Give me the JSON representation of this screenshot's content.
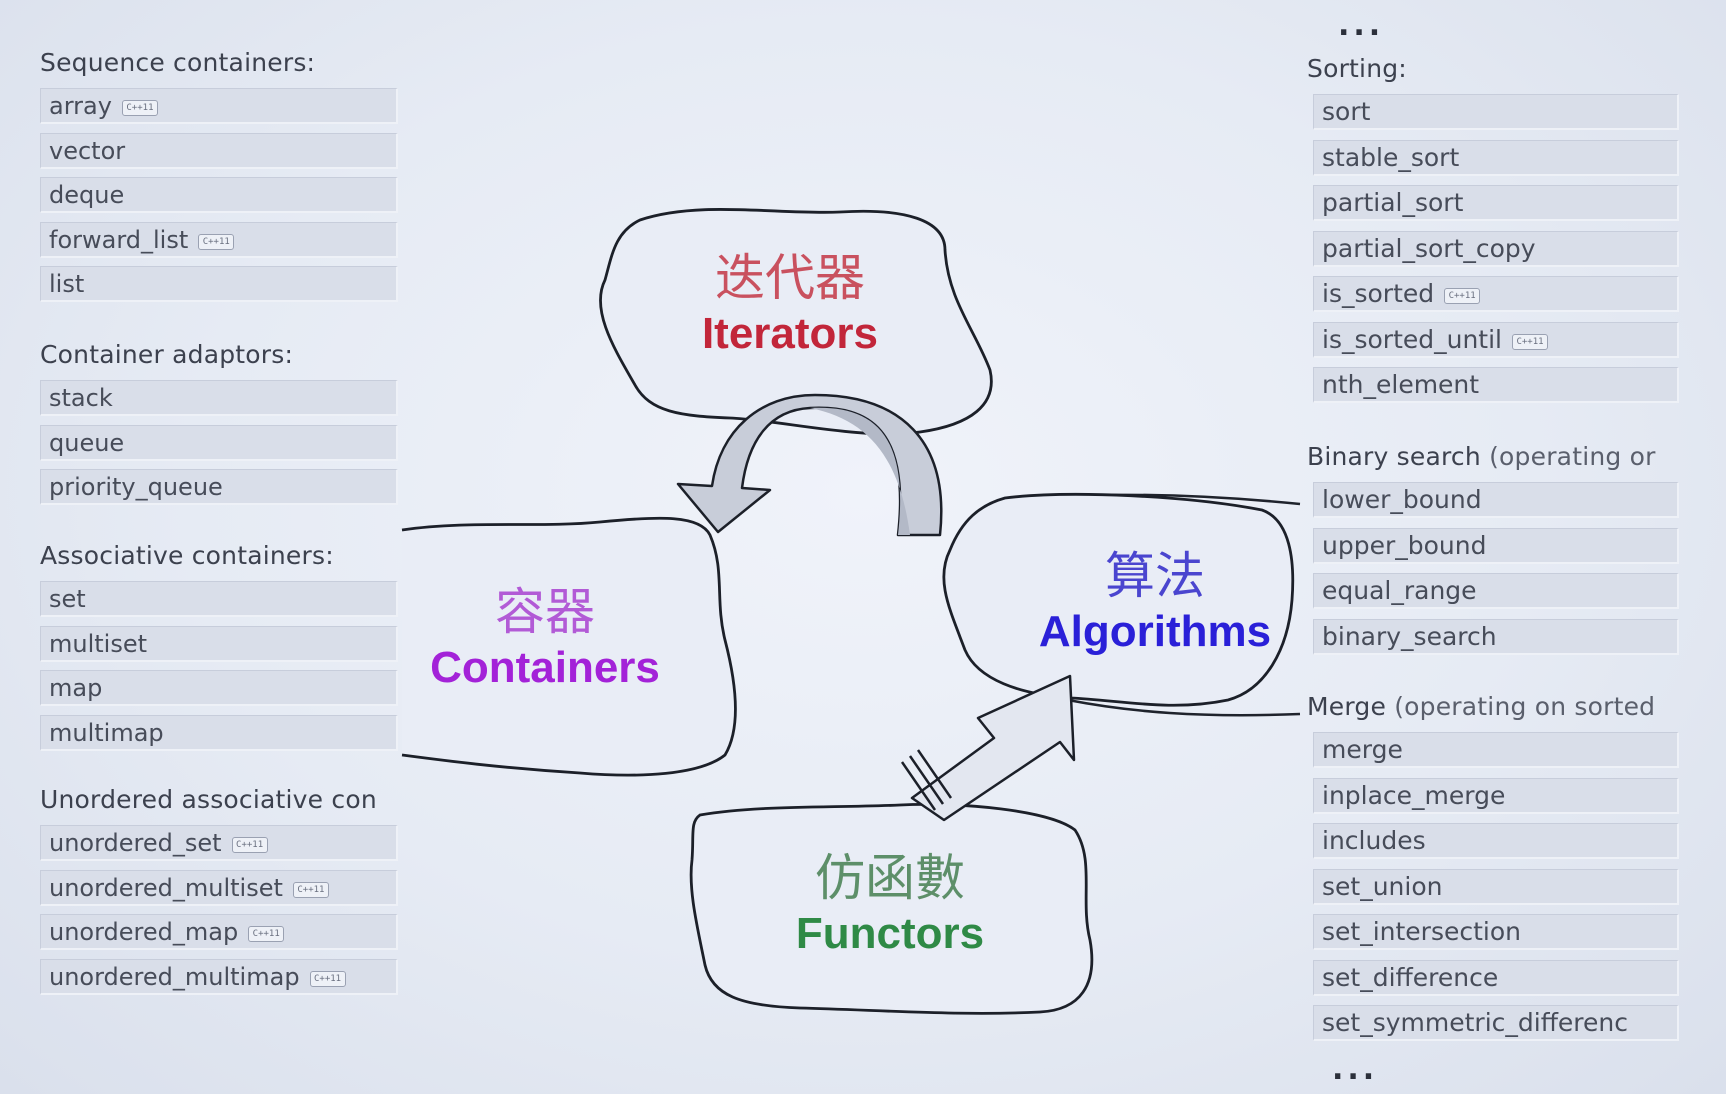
{
  "colors": {
    "iterators": "#c2263a",
    "iterators_cn": "#c9515f",
    "containers": "#a322d8",
    "containers_cn": "#b25ad6",
    "algorithms": "#2a20d8",
    "algorithms_cn": "#4a45cf",
    "functors": "#2f8a46",
    "functors_cn": "#5d8f69"
  },
  "left_groups": [
    {
      "heading": "Sequence containers:",
      "items": [
        {
          "label": "array",
          "cxx11": true
        },
        {
          "label": "vector",
          "cxx11": false
        },
        {
          "label": "deque",
          "cxx11": false
        },
        {
          "label": "forward_list",
          "cxx11": true
        },
        {
          "label": "list",
          "cxx11": false
        }
      ]
    },
    {
      "heading": "Container adaptors:",
      "items": [
        {
          "label": "stack",
          "cxx11": false
        },
        {
          "label": "queue",
          "cxx11": false
        },
        {
          "label": "priority_queue",
          "cxx11": false
        }
      ]
    },
    {
      "heading": "Associative containers:",
      "items": [
        {
          "label": "set",
          "cxx11": false
        },
        {
          "label": "multiset",
          "cxx11": false
        },
        {
          "label": "map",
          "cxx11": false
        },
        {
          "label": "multimap",
          "cxx11": false
        }
      ]
    },
    {
      "heading": "Unordered associative con",
      "items": [
        {
          "label": "unordered_set",
          "cxx11": true
        },
        {
          "label": "unordered_multiset",
          "cxx11": true
        },
        {
          "label": "unordered_map",
          "cxx11": true
        },
        {
          "label": "unordered_multimap",
          "cxx11": true
        }
      ]
    }
  ],
  "right_groups": [
    {
      "heading": "Sorting:",
      "note": "",
      "items": [
        {
          "label": "sort",
          "cxx11": false
        },
        {
          "label": "stable_sort",
          "cxx11": false
        },
        {
          "label": "partial_sort",
          "cxx11": false
        },
        {
          "label": "partial_sort_copy",
          "cxx11": false
        },
        {
          "label": "is_sorted",
          "cxx11": true
        },
        {
          "label": "is_sorted_until",
          "cxx11": true
        },
        {
          "label": "nth_element",
          "cxx11": false
        }
      ]
    },
    {
      "heading": "Binary search",
      "note": "(operating or",
      "items": [
        {
          "label": "lower_bound",
          "cxx11": false
        },
        {
          "label": "upper_bound",
          "cxx11": false
        },
        {
          "label": "equal_range",
          "cxx11": false
        },
        {
          "label": "binary_search",
          "cxx11": false
        }
      ]
    },
    {
      "heading": "Merge",
      "note": "(operating on sorted",
      "items": [
        {
          "label": "merge",
          "cxx11": false
        },
        {
          "label": "inplace_merge",
          "cxx11": false
        },
        {
          "label": "includes",
          "cxx11": false
        },
        {
          "label": "set_union",
          "cxx11": false
        },
        {
          "label": "set_intersection",
          "cxx11": false
        },
        {
          "label": "set_difference",
          "cxx11": false
        },
        {
          "label": "set_symmetric_differenc",
          "cxx11": false
        }
      ]
    }
  ],
  "badge_text": "C++11",
  "ellipsis": "...",
  "clouds": {
    "iterators": {
      "cn": "迭代器",
      "en": "Iterators"
    },
    "containers": {
      "cn": "容器",
      "en": "Containers"
    },
    "algorithms": {
      "cn": "算法",
      "en": "Algorithms"
    },
    "functors": {
      "cn": "仿函數",
      "en": "Functors"
    }
  }
}
